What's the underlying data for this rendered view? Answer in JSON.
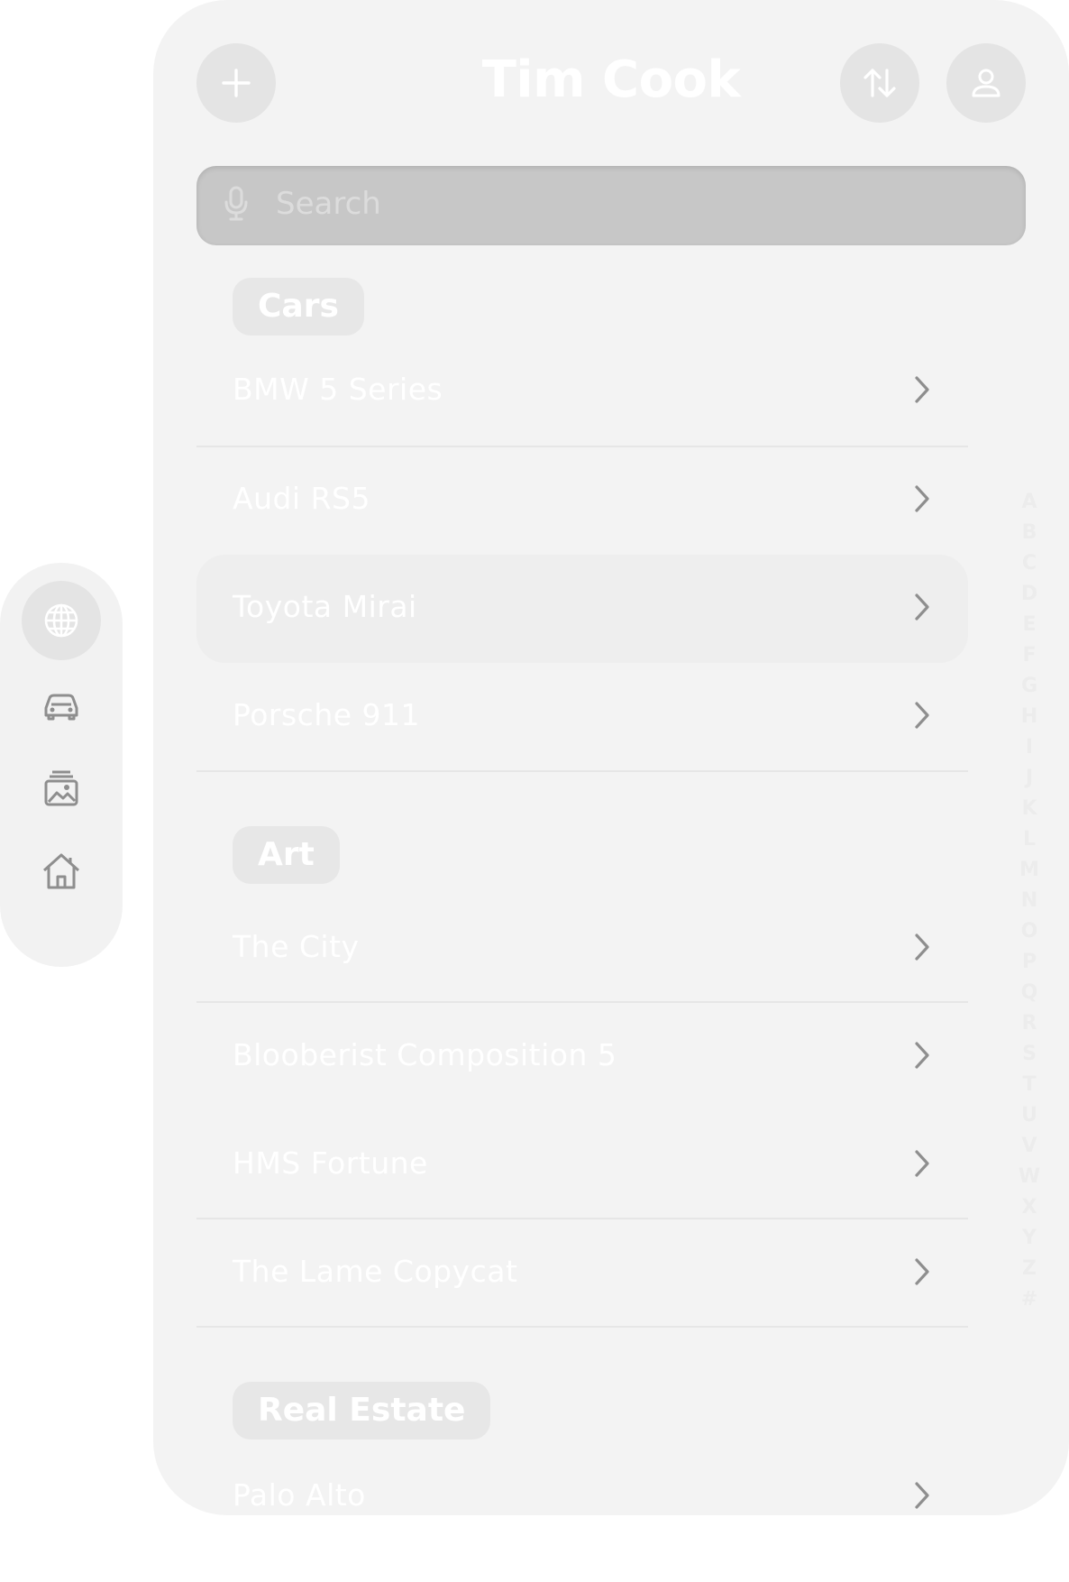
{
  "window": {
    "title": "Tim Cook",
    "search_placeholder": "Search"
  },
  "toolbar": {
    "add_icon": "plus-icon",
    "sort_icon": "arrow-up-down-icon",
    "profile_icon": "person-icon"
  },
  "tabbar": {
    "items": [
      {
        "icon": "globe-icon",
        "active": true
      },
      {
        "icon": "car-icon",
        "active": false
      },
      {
        "icon": "photo-stack-icon",
        "active": false
      },
      {
        "icon": "house-icon",
        "active": false
      }
    ]
  },
  "sections": [
    {
      "header": "Cars",
      "items": [
        "BMW 5 Series",
        "Audi RS5",
        "Toyota Mirai",
        "Porsche 911"
      ],
      "highlighted_item": "Toyota Mirai"
    },
    {
      "header": "Art",
      "items": [
        "The City",
        "Blooberist Composition 5",
        "HMS Fortune",
        "The Lame Copycat"
      ]
    },
    {
      "header": "Real Estate",
      "items": [
        "Palo Alto"
      ]
    }
  ],
  "index_letters": [
    "A",
    "B",
    "C",
    "D",
    "E",
    "F",
    "G",
    "H",
    "I",
    "J",
    "K",
    "L",
    "M",
    "N",
    "O",
    "P",
    "Q",
    "R",
    "S",
    "T",
    "U",
    "V",
    "W",
    "X",
    "Y",
    "Z",
    "#"
  ],
  "colors": {
    "window_bg": "#f3f3f3",
    "search_bg": "#c7c7c7",
    "icon_gray": "#8e8e8e"
  }
}
